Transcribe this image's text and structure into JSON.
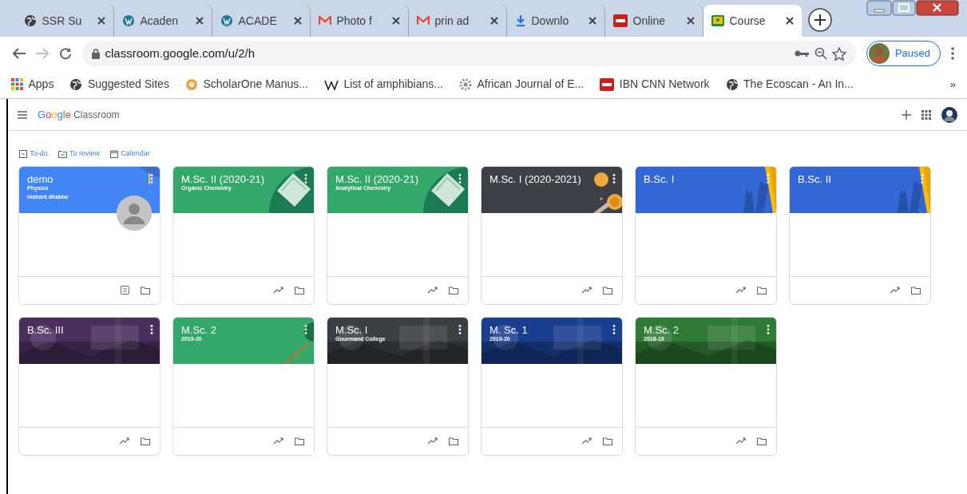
{
  "browser": {
    "tabs": [
      {
        "title": "SSR Su",
        "selected": false
      },
      {
        "title": "Acaden",
        "selected": false
      },
      {
        "title": "ACADE",
        "selected": false
      },
      {
        "title": "Photo f",
        "selected": false
      },
      {
        "title": "prin ad",
        "selected": false
      },
      {
        "title": "Downlo",
        "selected": false
      },
      {
        "title": "Online",
        "selected": false
      },
      {
        "title": "Course",
        "selected": true
      }
    ],
    "address": "classroom.google.com/u/2/h",
    "profile_status": "Paused",
    "bookmarks": [
      {
        "label": "Apps"
      },
      {
        "label": "Suggested Sites"
      },
      {
        "label": "ScholarOne Manus..."
      },
      {
        "label": "List of amphibians..."
      },
      {
        "label": "African Journal of E..."
      },
      {
        "label": "IBN CNN Network"
      },
      {
        "label": "The Ecoscan - An In..."
      }
    ],
    "bookmarks_more": "»"
  },
  "app": {
    "logo_brand": "Google",
    "logo_product": "Classroom",
    "links": [
      {
        "label": "To-do"
      },
      {
        "label": "To review"
      },
      {
        "label": "Calendar"
      }
    ],
    "cards": [
      {
        "title": "demo",
        "subtitle": "Physics",
        "teacher": "nishant dhabbe",
        "color": "#4285f4",
        "kind": "owner"
      },
      {
        "title": "M.Sc. II (2020-21)",
        "subtitle": "Organic Chemistry",
        "color": "#34a86b",
        "kind": "member"
      },
      {
        "title": "M.Sc. II (2020-21)",
        "subtitle": "Analytical Chemistry",
        "color": "#34a86b",
        "kind": "member"
      },
      {
        "title": "M.Sc. I (2020-2021)",
        "color": "#3c4148",
        "kind": "member"
      },
      {
        "title": "B.Sc. I",
        "color": "#3367d6",
        "kind": "member"
      },
      {
        "title": "B.Sc. II",
        "color": "#3367d6",
        "kind": "member"
      },
      {
        "title": "B.Sc. III",
        "kind": "member"
      },
      {
        "title": "M.Sc. 2",
        "subtitle": "2019-20",
        "color": "#34a86b",
        "kind": "member"
      },
      {
        "title": "M.Sc. I",
        "subtitle": "Gourmand College",
        "kind": "member"
      },
      {
        "title": "M. Sc. 1",
        "subtitle": "2019-20",
        "kind": "member"
      },
      {
        "title": "M.Sc. 2",
        "subtitle": "2018-19",
        "kind": "member"
      }
    ]
  }
}
